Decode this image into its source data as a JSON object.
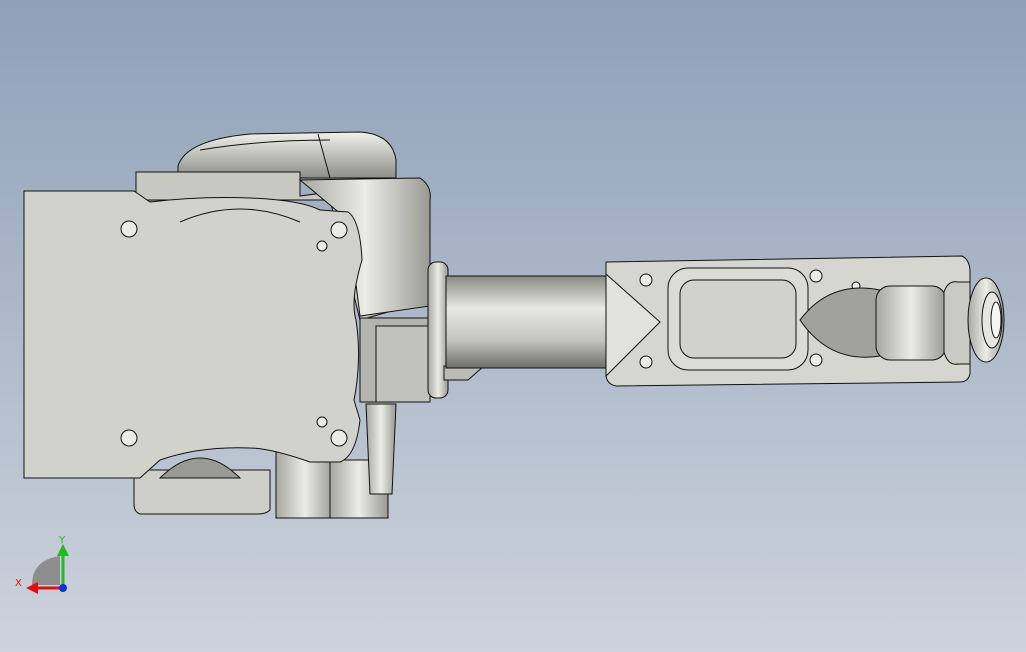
{
  "viewport": {
    "background_top": "#8fa0b8",
    "background_bottom": "#cdd3dc",
    "model_color": "#d2d2cc",
    "edge_color": "#111111"
  },
  "triad": {
    "x_label": "X",
    "y_label": "Y",
    "x_color": "#dd1111",
    "y_color": "#22bb22",
    "z_color": "#1133cc"
  }
}
